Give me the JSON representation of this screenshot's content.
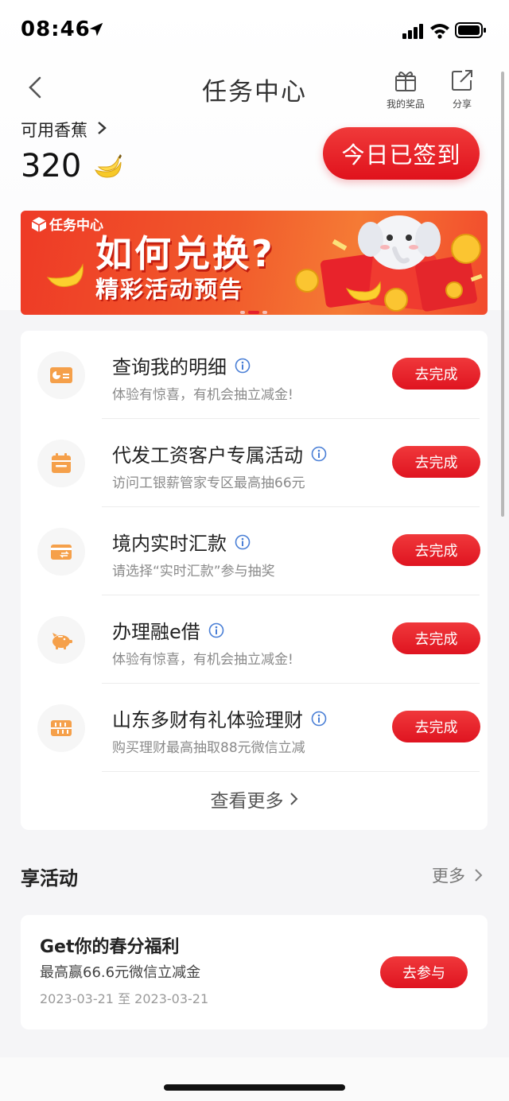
{
  "status_bar": {
    "time": "08:46"
  },
  "nav": {
    "title": "任务中心",
    "prizes_label": "我的奖品",
    "share_label": "分享"
  },
  "balance": {
    "label": "可用香蕉",
    "value": "320",
    "signin_label": "今日已签到"
  },
  "banner": {
    "tag": "任务中心",
    "title": "如何兑换?",
    "subtitle": "精彩活动预告"
  },
  "tasks": [
    {
      "title": "查询我的明细",
      "desc": "体验有惊喜，有机会抽立减金!",
      "button": "去完成",
      "icon": "detail-icon"
    },
    {
      "title": "代发工资客户专属活动",
      "desc": "访问工银薪管家专区最高抽66元",
      "button": "去完成",
      "icon": "calendar-icon"
    },
    {
      "title": "境内实时汇款",
      "desc": "请选择“实时汇款”参与抽奖",
      "button": "去完成",
      "icon": "transfer-card-icon"
    },
    {
      "title": "办理融e借",
      "desc": "体验有惊喜，有机会抽立减金!",
      "button": "去完成",
      "icon": "piggy-bank-icon"
    },
    {
      "title": "山东多财有礼体验理财",
      "desc": "购买理财最高抽取88元微信立减",
      "button": "去完成",
      "icon": "finance-icon"
    }
  ],
  "view_more": "查看更多",
  "activities": {
    "section_title": "享活动",
    "more_label": "更多",
    "items": [
      {
        "title": "Get你的春分福利",
        "desc": "最高赢66.6元微信立减金",
        "date": "2023-03-21 至 2023-03-21",
        "button": "去参与"
      }
    ]
  },
  "colors": {
    "accent": "#e5202a",
    "icon_orange": "#f5a04a",
    "banner": "#f15a2b"
  }
}
